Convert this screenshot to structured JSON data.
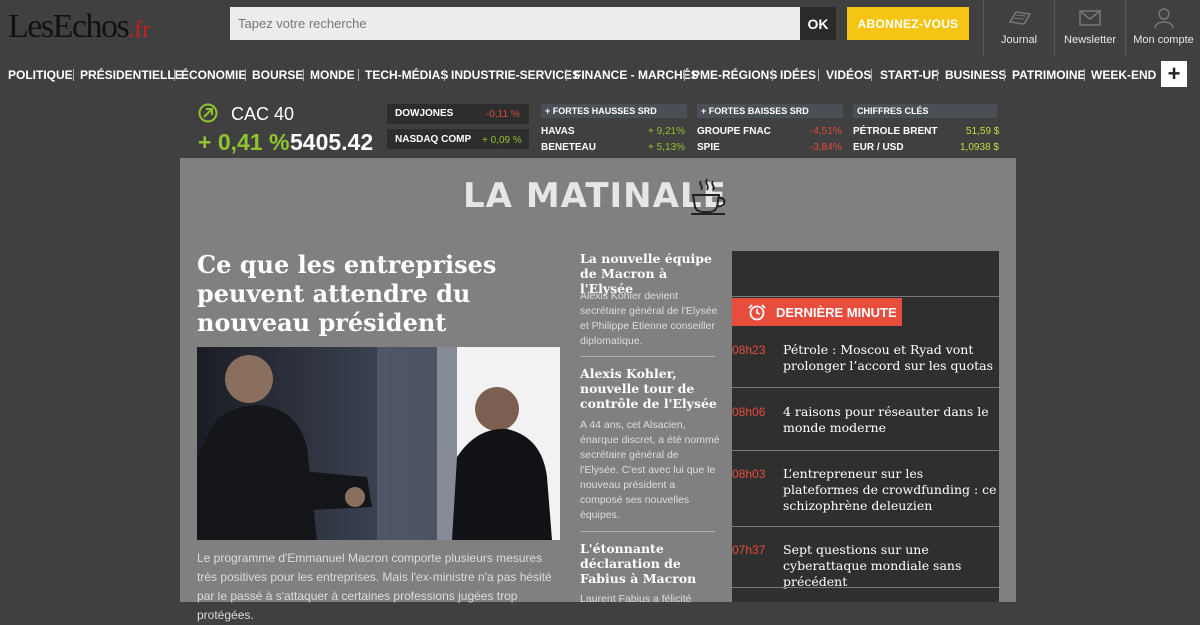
{
  "header": {
    "logo_main": "LesEchos",
    "logo_suffix": ".fr",
    "search_placeholder": "Tapez votre recherche",
    "ok_label": "OK",
    "subscribe_label": "ABONNEZ-VOUS",
    "links": [
      {
        "label": "Journal",
        "icon": "newspaper-icon"
      },
      {
        "label": "Newsletter",
        "icon": "envelope-icon"
      },
      {
        "label": "Mon compte",
        "icon": "user-icon"
      }
    ]
  },
  "nav": {
    "items": [
      "POLITIQUE",
      "PRÉSIDENTIELLE",
      "ÉCONOMIE",
      "BOURSE",
      "MONDE",
      "TECH-MÉDIAS",
      "INDUSTRIE-SERVICES",
      "FINANCE - MARCHÉS",
      "PME-RÉGIONS",
      "IDÉES",
      "VIDÉOS",
      "START-UP",
      "BUSINESS",
      "PATRIMOINE",
      "WEEK-END"
    ],
    "more_label": "+"
  },
  "markets": {
    "cac": {
      "name": "CAC 40",
      "variation": "+ 0,41 %",
      "value": "5405.42"
    },
    "indices": [
      {
        "name": "DOWJONES",
        "variation": "-0,11 %",
        "trend": "down"
      },
      {
        "name": "NASDAQ COMP",
        "variation": "+ 0,09 %",
        "trend": "up"
      }
    ],
    "hausses": {
      "title": "+ FORTES HAUSSES SRD",
      "rows": [
        {
          "name": "HAVAS",
          "value": "+ 9,21%"
        },
        {
          "name": "BENETEAU",
          "value": "+ 5,13%"
        }
      ]
    },
    "baisses": {
      "title": "+ FORTES BAISSES SRD",
      "rows": [
        {
          "name": "GROUPE FNAC",
          "value": "-4,51%"
        },
        {
          "name": "SPIE",
          "value": "-3,84%"
        }
      ]
    },
    "cles": {
      "title": "CHIFFRES CLÉS",
      "rows": [
        {
          "name": "PÉTROLE BRENT",
          "value": "51,59 $"
        },
        {
          "name": "EUR / USD",
          "value": "1,0938 $"
        }
      ]
    }
  },
  "matinale": {
    "title": "LA MATINALE",
    "main": {
      "title": "Ce que les entreprises peuvent attendre du nouveau président",
      "description": "Le programme d'Emmanuel Macron comporte plusieurs mesures très positives pour les entreprises. Mais l'ex-ministre n'a pas hésité par le passé à s'attaquer à certaines professions jugées trop protégées."
    },
    "side": [
      {
        "title": "La nouvelle équipe de Macron à l'Elysée",
        "description": "Alexis Kohler devient secrétaire général de l'Elysée et Philippe Etienne conseiller diplomatique."
      },
      {
        "title": "Alexis Kohler, nouvelle tour de contrôle de l'Elysée",
        "description": "A 44 ans, cet Alsacien, énarque discret, a été nommé secrétaire général de l'Elysée. C'est avec lui que le nouveau président a composé ses nouvelles équipes."
      },
      {
        "title": "L'étonnante déclaration de Fabius à Macron",
        "description": "Laurent Fabius a félicité"
      }
    ]
  },
  "derniere_minute": {
    "title": "DERNIÈRE MINUTE",
    "items": [
      {
        "time": "08h23",
        "prefix": "Pétrole : ",
        "text": "Moscou et Ryad vont prolonger l’accord sur les quotas"
      },
      {
        "time": "08h06",
        "prefix": "",
        "text": "4 raisons pour réseauter dans le monde moderne"
      },
      {
        "time": "08h03",
        "prefix": "L’entrepreneur sur les plateformes de crowdfunding : ",
        "text": "ce schizophrène deleuzien"
      },
      {
        "time": "07h37",
        "prefix": "",
        "text": "Sept questions sur une cyberattaque mondiale sans précédent"
      }
    ]
  },
  "colors": {
    "accent_red": "#e84c3d",
    "subscribe_yellow": "#f6c513",
    "up_green": "#8fc330"
  }
}
